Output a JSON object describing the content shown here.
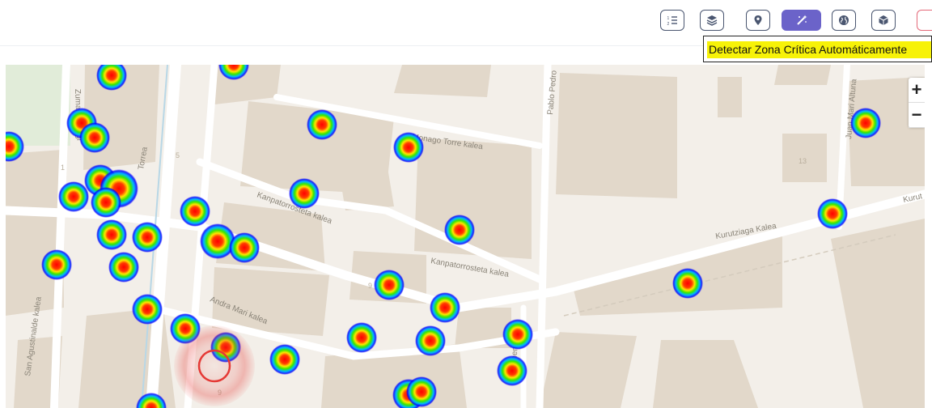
{
  "toolbar": {
    "buttons": [
      {
        "name": "list-numbered-button",
        "icon": "list-numbered-icon"
      },
      {
        "name": "layers-button",
        "icon": "layers-icon"
      },
      {
        "name": "location-pin-button",
        "icon": "map-pin-icon"
      },
      {
        "name": "detect-critical-zone-button",
        "icon": "magic-wand-icon",
        "active": true
      },
      {
        "name": "globe-button",
        "icon": "globe-icon"
      },
      {
        "name": "cube-button",
        "icon": "cube-icon"
      }
    ],
    "tooltip": "Detectar Zona Crítica Automáticamente"
  },
  "map": {
    "zoom_in": "+",
    "zoom_out": "−",
    "streets": {
      "monago": "Monago Torre kalea",
      "kanpatorrosteta_1": "Kanpatorrosteta kalea",
      "kanpatorrosteta_2": "Kanpatorrosteta kalea",
      "kurutziaga": "Kurutziaga Kalea",
      "kurut": "Kurut",
      "andra_mari": "Andra Mari kalea",
      "zumalakarregi": "Zumalakarregi",
      "san_agustinalde": "San Agustinalde kalea",
      "pablo_pedro": "Pablo Pedro",
      "juan_mari": "Juan Mari Altuna",
      "torrea": "Torrea",
      "komentu": "Komentu"
    },
    "house_numbers": {
      "n1": "1",
      "n5": "5",
      "n13": "13",
      "n9a": "9",
      "n9b": "9"
    },
    "colors": {
      "heat_core": "#ff0000",
      "heat_mid": "#ffff00",
      "heat_outer": "#00ff00",
      "heat_edge": "#0000ff",
      "critical_zone": "#e53935"
    }
  }
}
